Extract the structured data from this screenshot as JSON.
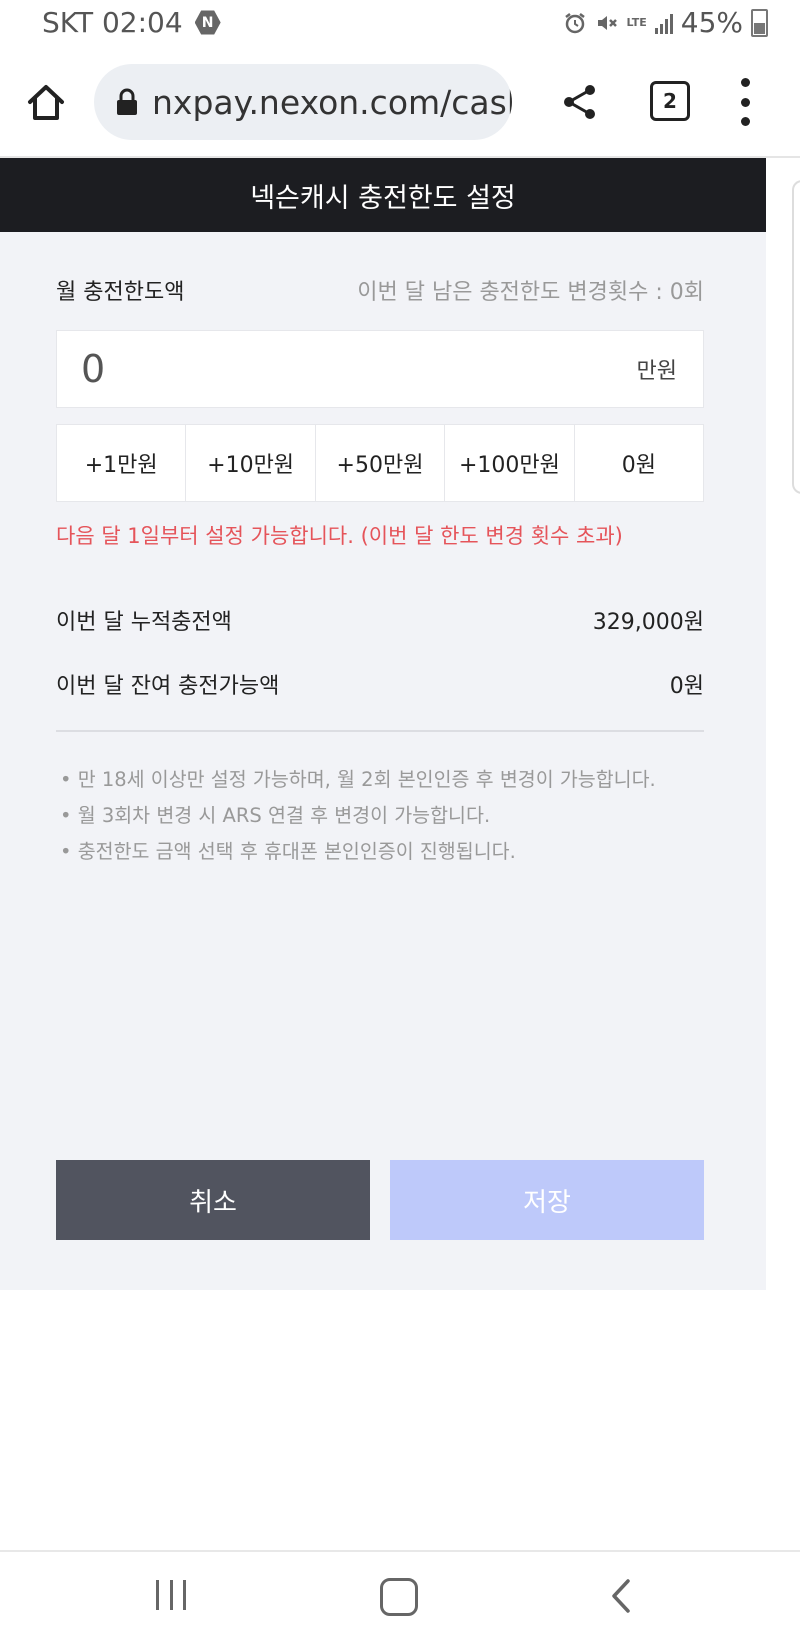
{
  "status_bar": {
    "carrier_time": "SKT 02:04",
    "badge": "N",
    "lte": "LTE",
    "battery": "45%",
    "icons": [
      "alarm-icon",
      "mute-icon",
      "signal-icon",
      "battery-icon"
    ]
  },
  "browser": {
    "url": "nxpay.nexon.com/cash",
    "tab_count": "2"
  },
  "page": {
    "title": "넥슨캐시 충전한도 설정",
    "monthly_limit_label": "월 충전한도액",
    "remaining_changes": "이번 달 남은 충전한도 변경횟수 : 0회",
    "amount_value": "0",
    "amount_unit": "만원",
    "quick_buttons": [
      "+1만원",
      "+10만원",
      "+50만원",
      "+100만원",
      "0원"
    ],
    "error_message": "다음 달 1일부터 설정 가능합니다. (이번 달 한도 변경 횟수 초과)",
    "info": [
      {
        "label": "이번 달 누적충전액",
        "value": "329,000원"
      },
      {
        "label": "이번 달 잔여 충전가능액",
        "value": "0원"
      }
    ],
    "notes": [
      "• 만 18세 이상만 설정 가능하며, 월 2회 본인인증 후 변경이 가능합니다.",
      "• 월 3회차 변경 시 ARS 연결 후 변경이 가능합니다.",
      "• 충전한도 금액 선택 후 휴대폰 본인인증이 진행됩니다."
    ],
    "cancel_label": "취소",
    "save_label": "저장"
  },
  "colors": {
    "header_bg": "#1c1d21",
    "error": "#e5545a",
    "cancel_bg": "#51545f",
    "save_bg_disabled": "#bec9fa",
    "page_bg": "#f2f3f7"
  }
}
